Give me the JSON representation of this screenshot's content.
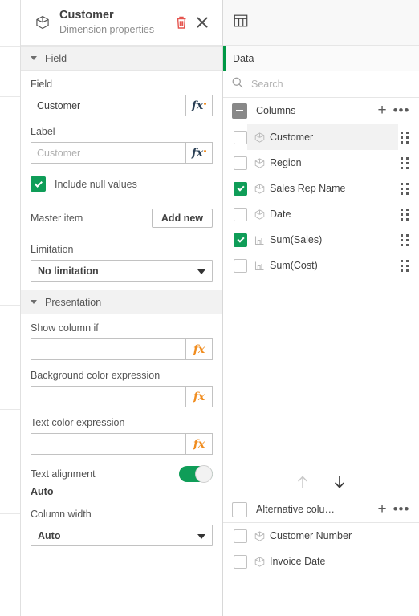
{
  "properties_panel": {
    "header": {
      "icon": "cube-icon",
      "title": "Customer",
      "subtitle": "Dimension properties",
      "delete_icon": "trash-icon",
      "close_icon": "close-icon"
    },
    "sections": {
      "field": {
        "label": "Field",
        "field_label": "Field",
        "field_value": "Customer",
        "field_placeholder": "Customer",
        "label_label": "Label",
        "label_value": "",
        "label_placeholder": "Customer",
        "include_null_label": "Include null values",
        "include_null_checked": true,
        "master_item_label": "Master item",
        "master_item_button": "Add new",
        "limitation_label": "Limitation",
        "limitation_value": "No limitation",
        "fx_icon": "function-expression-icon"
      },
      "presentation": {
        "label": "Presentation",
        "show_column_if_label": "Show column if",
        "show_column_if_value": "",
        "background_color_label": "Background color expression",
        "background_color_value": "",
        "text_color_label": "Text color expression",
        "text_color_value": "",
        "text_alignment_label": "Text alignment",
        "text_alignment_toggle_on": true,
        "text_alignment_value": "Auto",
        "column_width_label": "Column width",
        "column_width_value": "Auto"
      }
    }
  },
  "data_panel": {
    "topbar_icon": "table-chart-icon",
    "header_title": "Data",
    "search_placeholder": "Search",
    "search_value": "",
    "search_icon": "search-icon",
    "columns_group": {
      "label": "Columns",
      "checkbox_state": "indeterminate",
      "add_icon": "plus-icon",
      "more_icon": "ellipsis-icon",
      "items": [
        {
          "name": "Customer",
          "checked": false,
          "type_icon": "dimension-cube-icon",
          "hovered": true
        },
        {
          "name": "Region",
          "checked": false,
          "type_icon": "dimension-cube-icon",
          "hovered": false
        },
        {
          "name": "Sales Rep Name",
          "checked": true,
          "type_icon": "dimension-cube-icon",
          "hovered": false
        },
        {
          "name": "Date",
          "checked": false,
          "type_icon": "dimension-cube-icon",
          "hovered": false
        },
        {
          "name": "Sum(Sales)",
          "checked": true,
          "type_icon": "measure-bar-icon",
          "hovered": false
        },
        {
          "name": "Sum(Cost)",
          "checked": false,
          "type_icon": "measure-bar-icon",
          "hovered": false
        }
      ]
    },
    "move_bar": {
      "up_icon": "arrow-up-icon",
      "up_enabled": false,
      "down_icon": "arrow-down-icon",
      "down_enabled": true
    },
    "alternative_group": {
      "label": "Alternative colu…",
      "checkbox_state": "unchecked",
      "add_icon": "plus-icon",
      "more_icon": "ellipsis-icon",
      "items": [
        {
          "name": "Customer Number",
          "checked": false,
          "type_icon": "dimension-cube-icon"
        },
        {
          "name": "Invoice Date",
          "checked": false,
          "type_icon": "dimension-cube-icon"
        }
      ]
    }
  },
  "cursor": {
    "icon": "hand-pointer-cursor"
  },
  "colors": {
    "accent_green": "#009845",
    "check_green": "#0f9d58",
    "delete_red": "#e5554f",
    "fx_dark": "#2a3f54",
    "fx_orange": "#f08c1e",
    "text_primary": "#404040",
    "text_secondary": "#8c8c8c"
  }
}
